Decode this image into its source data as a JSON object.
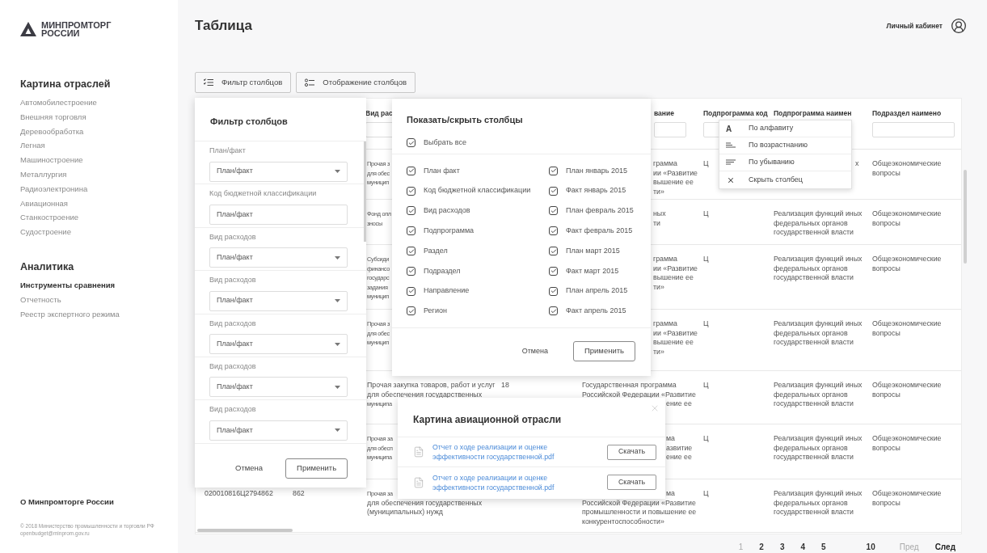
{
  "sidebar": {
    "logo": [
      "МИНПРОМТОРГ",
      "РОССИИ"
    ],
    "sections": [
      {
        "title": "Картина отраслей",
        "items": [
          {
            "label": "Автомобилестроение",
            "selected": false
          },
          {
            "label": "Внешняя торговля",
            "selected": false
          },
          {
            "label": "Деревообработка",
            "selected": false
          },
          {
            "label": "Легная",
            "selected": false
          },
          {
            "label": "Машиностроение",
            "selected": false
          },
          {
            "label": "Металлургия",
            "selected": false
          },
          {
            "label": "Радиоэлектронина",
            "selected": false
          },
          {
            "label": "Авиационная",
            "selected": false
          },
          {
            "label": "Станкостроение",
            "selected": false
          },
          {
            "label": "Судостроение",
            "selected": false
          }
        ]
      },
      {
        "title": "Аналитика",
        "items": [
          {
            "label": "Инструменты сравнения",
            "selected": true
          },
          {
            "label": "Отчетность",
            "selected": false
          },
          {
            "label": "Реестр экспертного режима",
            "selected": false
          }
        ]
      }
    ],
    "about": "О Минпромторге России",
    "footer": [
      "© 2018 Министерство промышленности и торговли РФ",
      "openbudget@minprom.gov.ru"
    ]
  },
  "header": {
    "title": "Таблица",
    "account": "Личный кабинет"
  },
  "toolbar": [
    {
      "label": "Фильтр столбцов",
      "kind": "filter"
    },
    {
      "label": "Отображение столбцов",
      "kind": "columns"
    }
  ],
  "table": {
    "columns": [
      {},
      {},
      {
        "header": "Вид рас",
        "filter": true
      },
      {},
      {
        "header": "вание",
        "filter": true
      },
      {
        "header": "Подпрограмма код",
        "filter": true
      },
      {
        "header": "Подпрограмма наимен"
      },
      {
        "header": "Подраздел наимено",
        "filter": true
      }
    ],
    "rows": [
      {
        "column_3": [
          "Прочая з",
          "для обес",
          "муницип"
        ],
        "column_5": [
          "грамма",
          "ии «Развитие",
          "вышение ее",
          "ти»"
        ],
        "column_6": [
          "Ц"
        ],
        "column_7": [
          "х"
        ],
        "column_8": [
          "Общеэкономические",
          "вопросы"
        ]
      },
      {
        "column_3": [
          "Фонд опл",
          "зносы"
        ],
        "column_5": [
          "ных",
          "ти"
        ],
        "column_6": [
          "Ц"
        ],
        "column_7": [
          "Реализация функций иных",
          "федеральных органов",
          "государственной власти"
        ],
        "column_8": [
          "Общеэкономические",
          "вопросы"
        ]
      },
      {
        "column_3": [
          "Субсиди",
          "финансо",
          "государс",
          "задания",
          "муницип"
        ],
        "column_5": [
          "грамма",
          "ии «Развитие",
          "вышение ее",
          "ти»"
        ],
        "column_6": [
          "Ц"
        ],
        "column_7": [
          "Реализация функций иных",
          "федеральных органов",
          "государственной власти"
        ],
        "column_8": [
          "Общеэкономические",
          "вопросы"
        ]
      },
      {
        "column_3": [
          "Прочая з",
          "для обес",
          "муницип"
        ],
        "column_5": [
          "грамма",
          "ии «Развитие",
          "вышение ее",
          "ти»"
        ],
        "column_6": [
          "Ц"
        ],
        "column_7": [
          "Реализация функций иных",
          "федеральных органов",
          "государственной власти"
        ],
        "column_8": [
          "Общеэкономические",
          "вопросы"
        ]
      },
      {
        "column_3": [
          "Прочая закупка товаров, работ и услуг",
          "для обеспечения государственных",
          "муниципа"
        ],
        "column_4": [
          "18"
        ],
        "column_5": [
          "Государственная программа",
          "Российской Федерации «Развитие",
          "ение ее"
        ],
        "column_6": [
          "Ц"
        ],
        "column_7": [
          "Реализация функций иных",
          "федеральных органов",
          "государственной власти"
        ],
        "column_8": [
          "Общеэкономические",
          "вопросы"
        ]
      },
      {
        "column_3": [
          "Прочая за",
          "для обесп",
          "муниципа"
        ],
        "column_5": [
          "ма",
          "азвитие",
          "ение ее"
        ],
        "column_6": [
          "Ц"
        ],
        "column_7": [
          "Реализация функций иных",
          "федеральных органов",
          "государственной власти"
        ],
        "column_8": [
          "Общеэкономические",
          "вопросы"
        ]
      },
      {
        "column_1": [
          "020010816Ц2794862"
        ],
        "column_2": [
          "862"
        ],
        "column_3": [
          "Прочая за",
          "для обеспечения государственных",
          "(муниципальных) нужд"
        ],
        "column_5": [
          "ма",
          "Российской Федерации «Развитие",
          "промышленности и повышение ее",
          "конкурентоспособности»"
        ],
        "column_6": [
          "Ц"
        ],
        "column_7": [
          "Реализация функций иных",
          "федеральных органов",
          "государственной власти"
        ],
        "column_8": [
          "Общеэкономические",
          "вопросы"
        ]
      }
    ]
  },
  "pagination": {
    "pages": [
      {
        "label": "1",
        "selected": true
      },
      {
        "label": "2",
        "selected": false
      },
      {
        "label": "3",
        "selected": false
      },
      {
        "label": "4",
        "selected": false
      },
      {
        "label": "5",
        "selected": false
      },
      {
        "label": "10",
        "selected": false
      }
    ],
    "prev": {
      "label": "Пред",
      "disabled": true
    },
    "next": {
      "label": "След",
      "disabled": false
    }
  },
  "filter_panel": {
    "title": "Фильтр столбцов",
    "fields": [
      {
        "label": "План/факт",
        "kind": "select",
        "value": "План/факт"
      },
      {
        "label": "Код бюджетной классификации",
        "kind": "input",
        "value": "План/факт"
      },
      {
        "label": "Вид расходов",
        "kind": "select",
        "value": "План/факт"
      },
      {
        "label": "Вид расходов",
        "kind": "select",
        "value": "План/факт"
      },
      {
        "label": "Вид расходов",
        "kind": "select",
        "value": "План/факт"
      },
      {
        "label": "Вид расходов",
        "kind": "select",
        "value": "План/факт"
      },
      {
        "label": "Вид расходов",
        "kind": "select",
        "value": "План/факт"
      }
    ],
    "cancel": "Отмена",
    "apply": "Применить"
  },
  "columns_panel": {
    "title": "Показать/скрыть столбцы",
    "select_all": {
      "label": "Выбрать все",
      "checked": true
    },
    "left": [
      {
        "label": "План факт",
        "checked": true
      },
      {
        "label": "Код бюджетной классификации",
        "checked": true
      },
      {
        "label": "Вид расходов",
        "checked": true
      },
      {
        "label": "Подпрограмма",
        "checked": true
      },
      {
        "label": "Раздел",
        "checked": true
      },
      {
        "label": "Подраздел",
        "checked": true
      },
      {
        "label": "Направление",
        "checked": true
      },
      {
        "label": "Регион",
        "checked": true
      }
    ],
    "right": [
      {
        "label": "План январь 2015",
        "checked": true
      },
      {
        "label": "Факт январь 2015",
        "checked": true
      },
      {
        "label": "План февраль 2015",
        "checked": true
      },
      {
        "label": "Факт февраль 2015",
        "checked": true
      },
      {
        "label": "План март 2015",
        "checked": true
      },
      {
        "label": "Факт март 2015",
        "checked": true
      },
      {
        "label": "План апрель 2015",
        "checked": true
      },
      {
        "label": "Факт апрель 2015",
        "checked": true
      }
    ],
    "cancel": "Отмена",
    "apply": "Применить"
  },
  "sort_menu": [
    {
      "kind": "alpha",
      "glyph": "A",
      "label": "По алфавиту"
    },
    {
      "kind": "asc",
      "label": "По возрастнанию"
    },
    {
      "kind": "desc",
      "label": "По убыванию"
    },
    {
      "kind": "hide",
      "label": "Скрыть столбец"
    }
  ],
  "modal": {
    "title": "Картина авиационной отрасли",
    "files": [
      {
        "name": "Отчет о ходе реализации и оценке эффективности государственной.pdf",
        "button": "Скачать"
      },
      {
        "name": "Отчет о ходе реализации и оценке эффективности государственной.pdf",
        "button": "Скачать"
      }
    ]
  }
}
